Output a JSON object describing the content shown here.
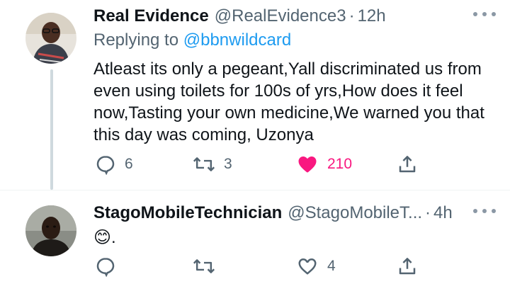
{
  "tweets": [
    {
      "display_name": "Real Evidence",
      "handle": "@RealEvidence3",
      "separator": "·",
      "time": "12h",
      "replying_prefix": "Replying to ",
      "replying_to": "@bbnwildcard",
      "text": "Atleast its only a pegeant,Yall discriminated us from even using toilets for 100s of yrs,How does it feel now,Tasting your own medicine,We warned you that this day was coming, Uzonya",
      "reply_count": "6",
      "retweet_count": "3",
      "like_count": "210",
      "liked": true,
      "avatar_icon": "person-avatar"
    },
    {
      "display_name": "StagoMobileTechnician",
      "handle": "@StagoMobileT...",
      "separator": "·",
      "time": "4h",
      "text": "😊.",
      "reply_count": "",
      "retweet_count": "",
      "like_count": "4",
      "liked": false,
      "avatar_icon": "person-avatar"
    }
  ],
  "colors": {
    "accent": "#1d9bf0",
    "like": "#f91880",
    "muted": "#536471",
    "thread_line": "#cfd9de"
  }
}
